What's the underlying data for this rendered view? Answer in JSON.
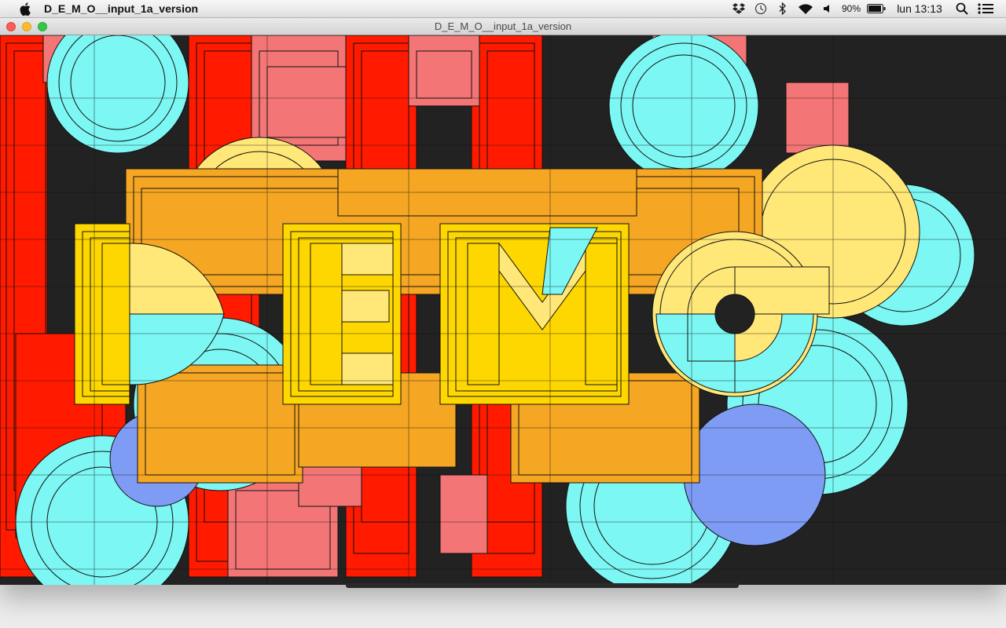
{
  "menubar": {
    "app_name": "D_E_M_O__input_1a_version",
    "battery_percent": "90%",
    "clock": "lun 13:13",
    "status_icons": [
      "dropbox-icon",
      "time-machine-icon",
      "bluetooth-icon",
      "wifi-icon",
      "volume-icon",
      "battery-icon",
      "spotlight-icon",
      "notification-center-icon"
    ]
  },
  "window": {
    "title": "D_E_M_O__input_1a_version",
    "background": "#222222"
  },
  "artwork": {
    "letters": "DEMO",
    "colors": {
      "red": "#ff1a00",
      "salmon": "#f47575",
      "cyan": "#7df7f3",
      "yellow": "#ffd700",
      "light_yellow": "#ffe878",
      "orange": "#f5a623",
      "blue": "#7f9cf5"
    }
  }
}
